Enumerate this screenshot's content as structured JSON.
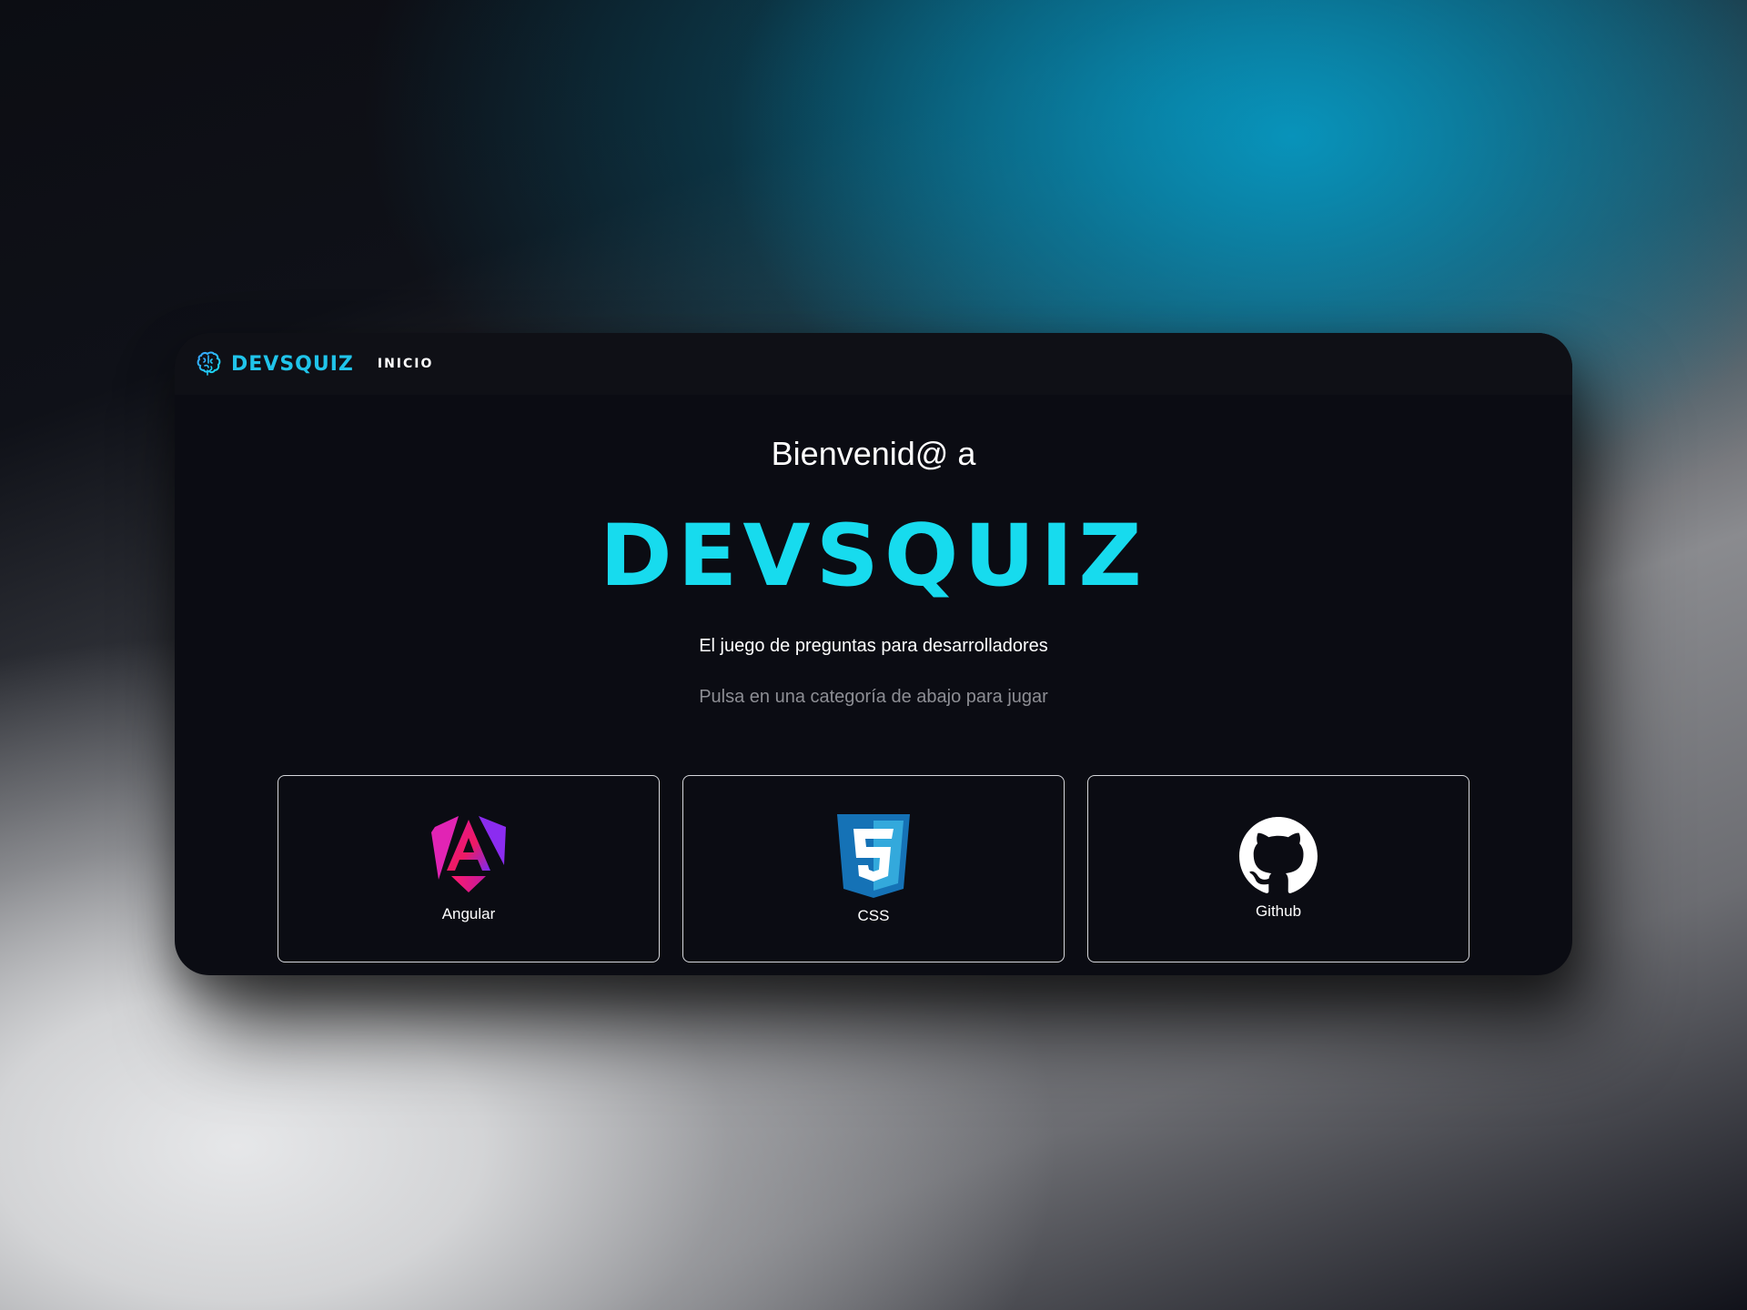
{
  "navbar": {
    "brand_name": "DEVSQUIZ",
    "brand_icon": "brain-icon",
    "links": [
      {
        "label": "INICIO"
      }
    ]
  },
  "hero": {
    "welcome": "Bienvenid@ a",
    "title": "DEVSQUIZ",
    "subtitle": "El juego de preguntas para desarrolladores",
    "hint": "Pulsa en una categoría de abajo para jugar"
  },
  "categories": [
    {
      "label": "Angular",
      "icon": "angular-icon"
    },
    {
      "label": "CSS",
      "icon": "css3-icon"
    },
    {
      "label": "Github",
      "icon": "github-icon"
    }
  ],
  "colors": {
    "accent": "#17dbee",
    "window_bg": "#0b0c13",
    "navbar_bg": "#0f1016",
    "hint_text": "#8d8e94",
    "card_border": "#d7d8dc"
  }
}
